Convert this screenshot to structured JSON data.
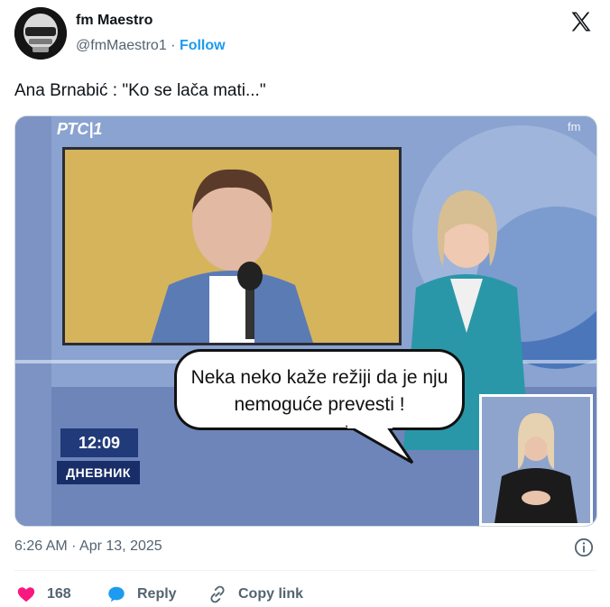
{
  "author": {
    "name": "fm Maestro",
    "handle": "@fmMaestro1",
    "separator": " · ",
    "follow_label": "Follow"
  },
  "tweet": {
    "text": "Ana Brnabić : \"Ko se lača mati...\"",
    "timestamp": "6:26 AM · Apr 13, 2025"
  },
  "media": {
    "channel_logo": "РТС|1",
    "watermark": "fm",
    "speech_bubble": "Neka neko kaže režiji da je nju nemoguće prevesti !",
    "clock": "12:09",
    "show_name": "ДНЕВНИК"
  },
  "actions": {
    "like_count": "168",
    "reply_label": "Reply",
    "copy_label": "Copy link"
  },
  "colors": {
    "accent": "#1d9bf0",
    "like": "#f91880",
    "muted": "#536471"
  }
}
